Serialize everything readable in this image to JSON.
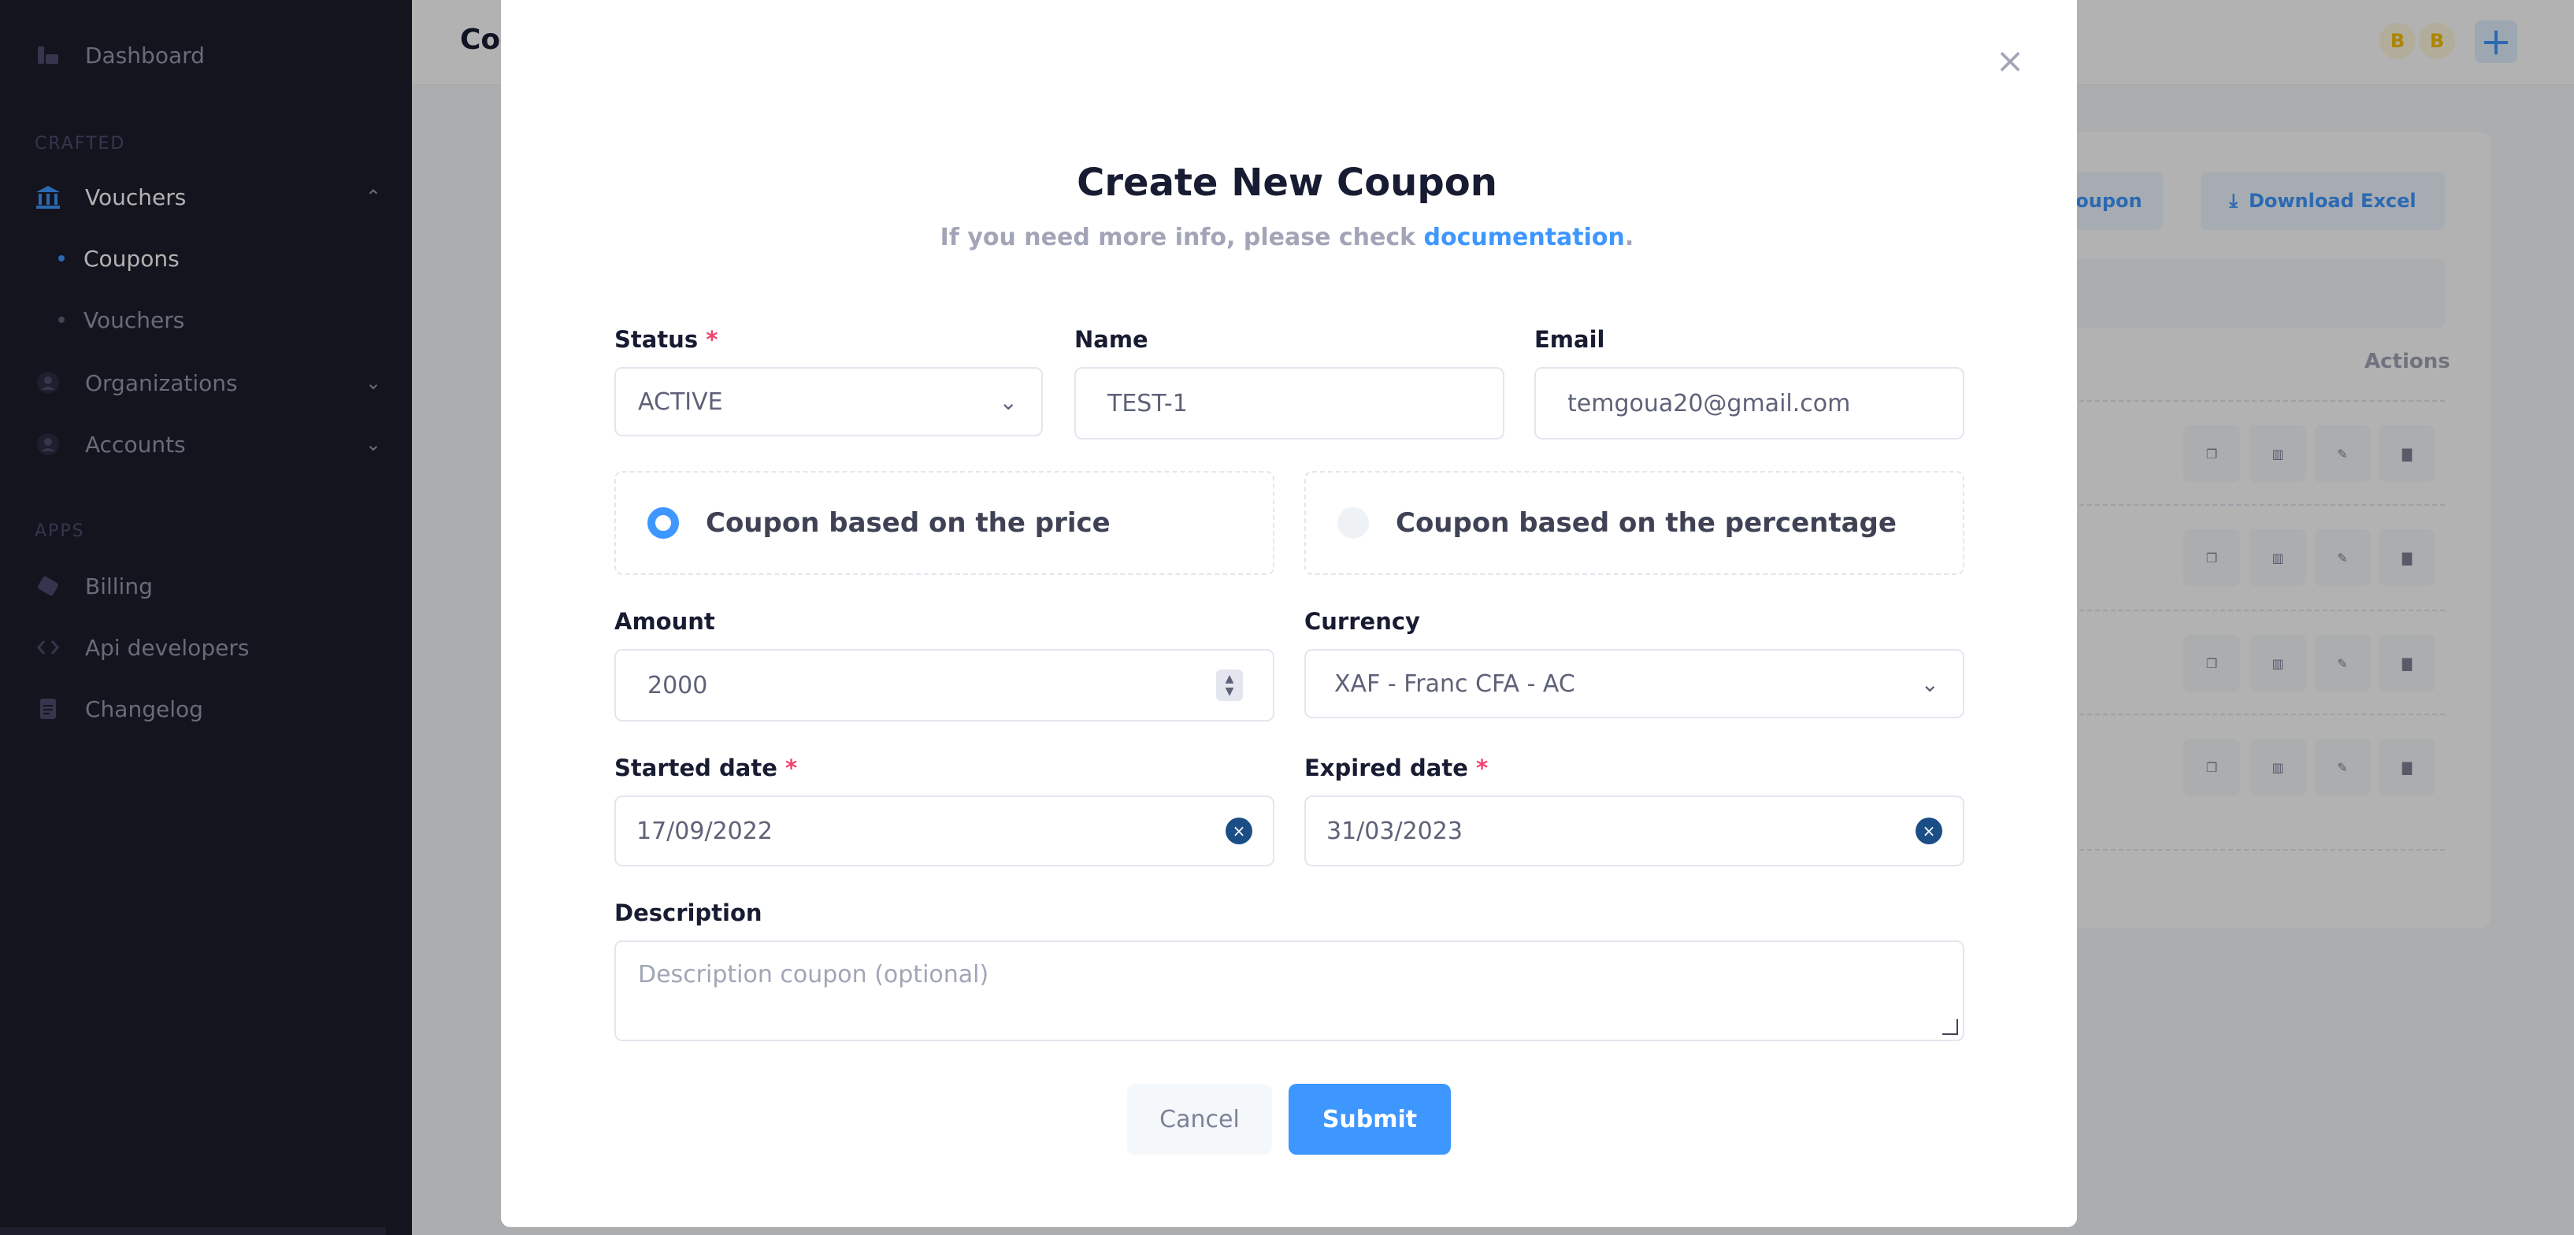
{
  "sidebar": {
    "dashboard": "Dashboard",
    "section_crafted": "CRAFTED",
    "vouchers_group": "Vouchers",
    "sub_coupons": "Coupons",
    "sub_vouchers": "Vouchers",
    "organizations": "Organizations",
    "accounts": "Accounts",
    "section_apps": "APPS",
    "billing": "Billing",
    "api_developers": "Api developers",
    "changelog": "Changelog"
  },
  "header": {
    "title_partial": "Cou",
    "avatars": [
      "B",
      "B"
    ],
    "add_symbol": "+"
  },
  "background": {
    "create_coupon_partial": "e coupon",
    "download_excel": "Download Excel",
    "actions_header": "Actions"
  },
  "modal": {
    "title": "Create New Coupon",
    "subtitle_prefix": "If you need more info, please check ",
    "subtitle_link": "documentation",
    "subtitle_suffix": ".",
    "status_label": "Status",
    "status_value": "ACTIVE",
    "name_label": "Name",
    "name_value": "TEST-1",
    "email_label": "Email",
    "email_value": "temgoua20@gmail.com",
    "radio_price": "Coupon based on the price",
    "radio_percentage": "Coupon based on the percentage",
    "amount_label": "Amount",
    "amount_value": "2000",
    "currency_label": "Currency",
    "currency_value": "XAF - Franc CFA - AC",
    "started_label": "Started date",
    "started_value": "17/09/2022",
    "expired_label": "Expired date",
    "expired_value": "31/03/2023",
    "description_label": "Description",
    "description_placeholder": "Description coupon (optional)",
    "cancel": "Cancel",
    "submit": "Submit",
    "required_mark": "*"
  },
  "colors": {
    "primary": "#3e97ff",
    "sidebar_bg": "#1e1e2d",
    "required": "#f1416c"
  }
}
